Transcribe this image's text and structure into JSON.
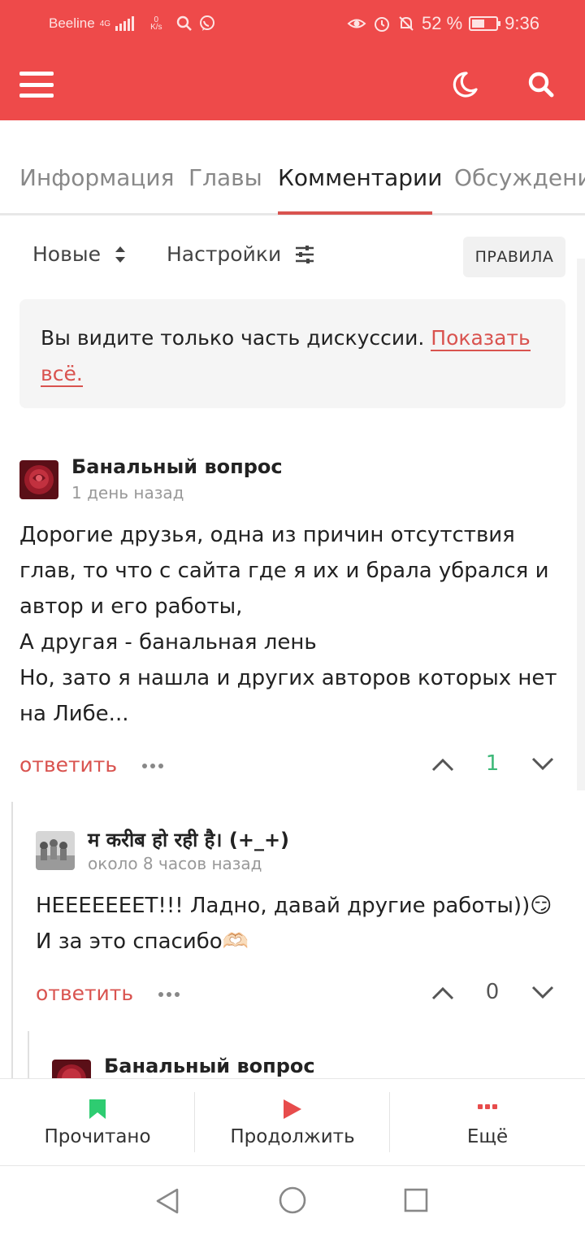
{
  "status_bar": {
    "carrier": "Beeline",
    "network": "4G",
    "speed_value": "0",
    "speed_unit": "K/s",
    "battery_percent": "52 %",
    "battery_level": 0.52,
    "time": "9:36"
  },
  "app_bar": {
    "background_color": "#ee4a4a",
    "menu_icon": "hamburger-icon",
    "theme_icon": "moon-icon",
    "search_icon": "search-icon"
  },
  "tabs": [
    {
      "label": "Информация",
      "active": false
    },
    {
      "label": "Главы",
      "active": false
    },
    {
      "label": "Комментарии",
      "active": true
    },
    {
      "label": "Обсуждения",
      "active": false
    }
  ],
  "toolbar": {
    "sort_label": "Новые",
    "settings_label": "Настройки",
    "rules_label": "ПРАВИЛА"
  },
  "notice": {
    "text": "Вы видите только часть дискуссии.",
    "link": "Показать всё."
  },
  "comments": [
    {
      "author": "Банальный вопрос",
      "time": "1 день назад",
      "lines": [
        "Дорогие друзья, одна из причин отсутствия",
        "глав, то что с сайта где я их и брала убрался и",
        "автор и его работы,",
        "А другая - банальная лень",
        "Но, зато я нашла и других авторов которых нет",
        "на Либе..."
      ],
      "reply_label": "ответить",
      "score": "1",
      "score_color": "#3cb878"
    },
    {
      "author": "म करीब हो रही है। (+_+)",
      "time": "около 8 часов назад",
      "lines": [
        "НЕЕЕЕЕЕЕТ!!! Ладно, давай другие работы))😏",
        "И за это спасибо🫶🏻"
      ],
      "reply_label": "ответить",
      "score": "0",
      "score_color": "#555555"
    },
    {
      "author": "Банальный вопрос"
    }
  ],
  "bottom_nav": [
    {
      "label": "Прочитано",
      "icon": "bookmark-icon",
      "color": "#2ecc71"
    },
    {
      "label": "Продолжить",
      "icon": "play-icon",
      "color": "#e74c4c"
    },
    {
      "label": "Ещё",
      "icon": "more-dots-icon",
      "color": "#e74c4c"
    }
  ],
  "system_nav": {
    "back_icon": "back-triangle-icon",
    "home_icon": "home-circle-icon",
    "recents_icon": "recents-square-icon"
  }
}
